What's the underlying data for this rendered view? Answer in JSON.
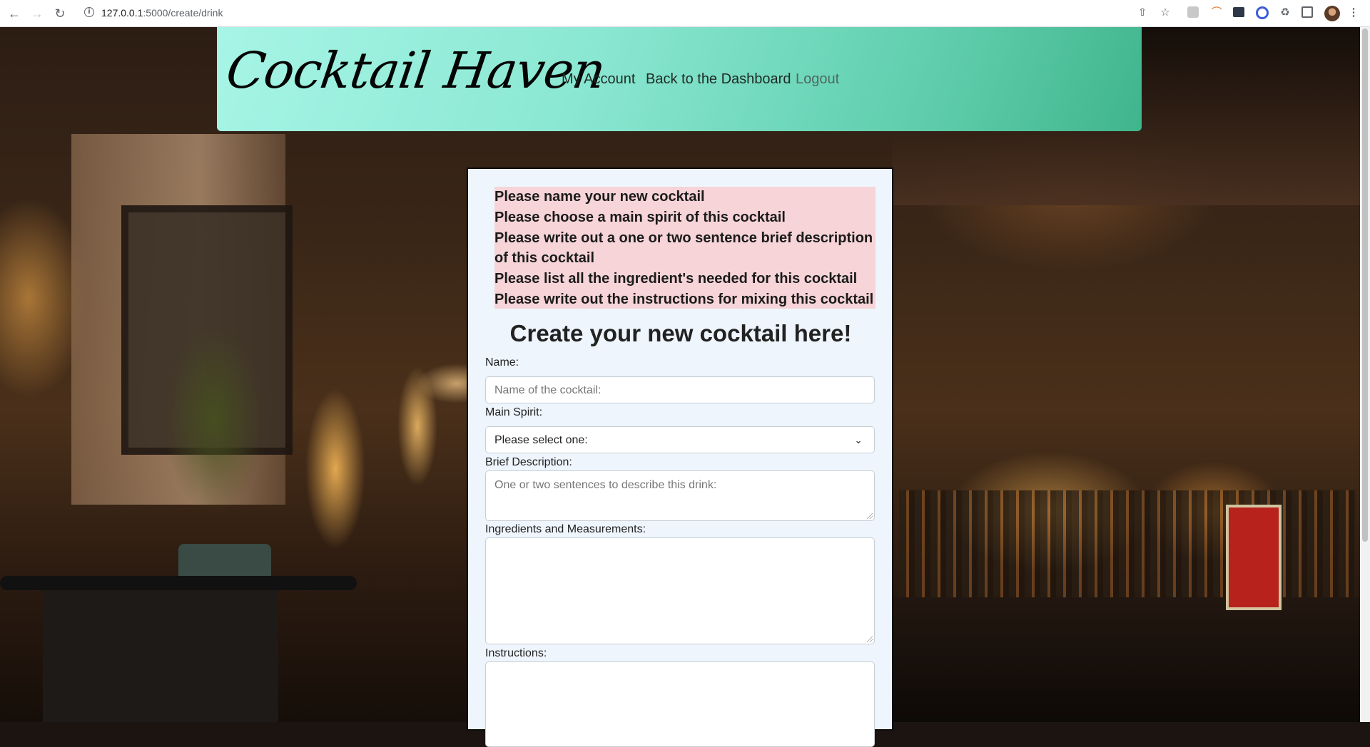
{
  "browser": {
    "url_host": "127.0.0.1",
    "url_path": ":5000/create/drink",
    "back_icon": "arrow-left-icon",
    "forward_icon": "arrow-right-icon",
    "reload_icon": "reload-icon"
  },
  "header": {
    "brand": "Cocktail Haven",
    "nav": {
      "account": "My Account",
      "dashboard": "Back to the Dashboard",
      "logout": "Logout"
    }
  },
  "errors": [
    "Please name your new cocktail",
    "Please choose a main spirit of this cocktail",
    "Please write out a one or two sentence brief description of this cocktail",
    "Please list all the ingredient's needed for this cocktail",
    "Please write out the instructions for mixing this cocktail"
  ],
  "form": {
    "title": "Create your new cocktail here!",
    "name_label": "Name:",
    "name_placeholder": "Name of the cocktail:",
    "spirit_label": "Main Spirit:",
    "spirit_selected": "Please select one:",
    "description_label": "Brief Description:",
    "description_placeholder": "One or two sentences to describe this drink:",
    "ingredients_label": "Ingredients and Measurements:",
    "instructions_label": "Instructions:"
  }
}
